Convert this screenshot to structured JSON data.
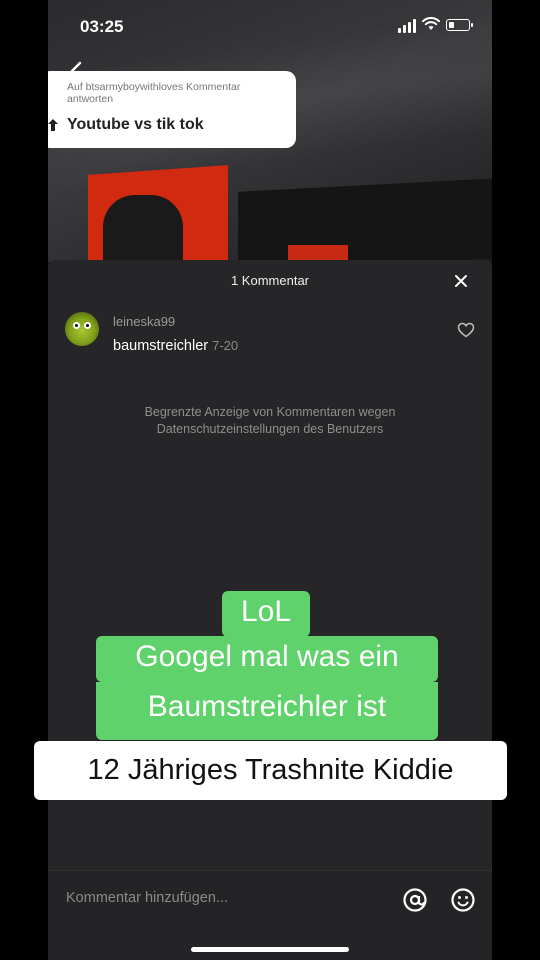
{
  "status_bar": {
    "time": "03:25",
    "battery_level": 0.3
  },
  "reply_card": {
    "subtitle": "Auf btsarmyboywithloves Kommentar antworten",
    "title": "Youtube vs tik tok"
  },
  "sheet": {
    "title": "1 Kommentar",
    "comment": {
      "username": "leineska99",
      "text": "baumstreichler",
      "date": "7-20"
    },
    "notice": "Begrenzte Anzeige von Kommentaren wegen Datenschutzeinstellungen des Benutzers",
    "input_placeholder": "Kommentar hinzufügen..."
  },
  "captions": {
    "line1": "LoL",
    "line2": "Googel mal was ein",
    "line3": "Baumstreichler ist",
    "line4": "12 Jähriges Trashnite Kiddie"
  },
  "icons": {
    "back": "chevron-left-icon",
    "close": "close-icon",
    "like": "heart-icon",
    "mention": "at-icon",
    "emoji": "smiley-icon"
  },
  "colors": {
    "caption_green": "#5fd26b",
    "sheet_bg": "#262628"
  }
}
